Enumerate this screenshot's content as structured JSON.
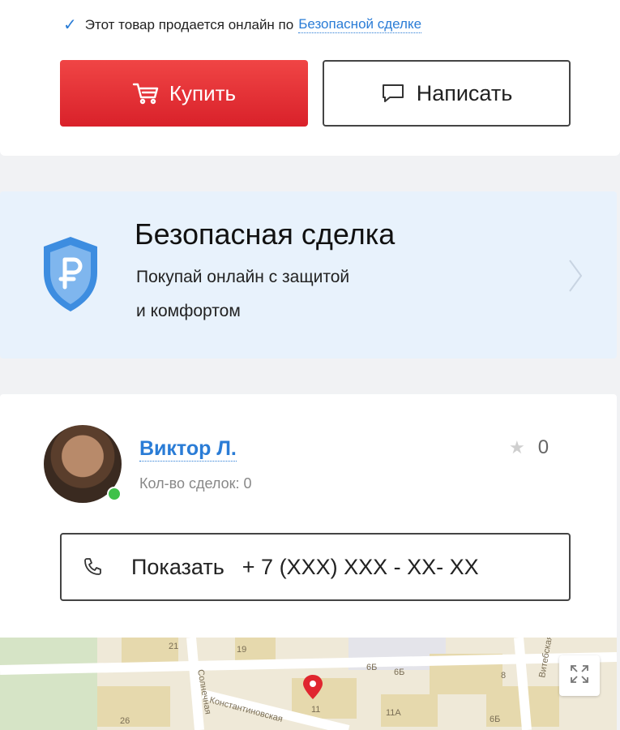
{
  "purchase": {
    "safe_text": "Этот товар продается онлайн по",
    "safe_link": "Безопасной сделке",
    "buy_label": "Купить",
    "write_label": "Написать"
  },
  "banner": {
    "title": "Безопасная сделка",
    "subtitle_line1": "Покупай онлайн с защитой",
    "subtitle_line2": "и комфортом"
  },
  "seller": {
    "name": "Виктор Л.",
    "deals": "Кол-во сделок: 0",
    "rating": "0",
    "show_label": "Показать",
    "phone": "+ 7 (XXX) XXX - XX- XX"
  },
  "map": {
    "labels": [
      "21",
      "19",
      "6Б",
      "6Б",
      "8",
      "26",
      "11",
      "11А",
      "6Б",
      "Солнечная",
      "Константиновская",
      "Витебская ул."
    ]
  },
  "colors": {
    "accent": "#2a7cd6",
    "buy": "#e0262f",
    "banner_bg": "#e8f2fc",
    "online": "#3fc14a"
  }
}
